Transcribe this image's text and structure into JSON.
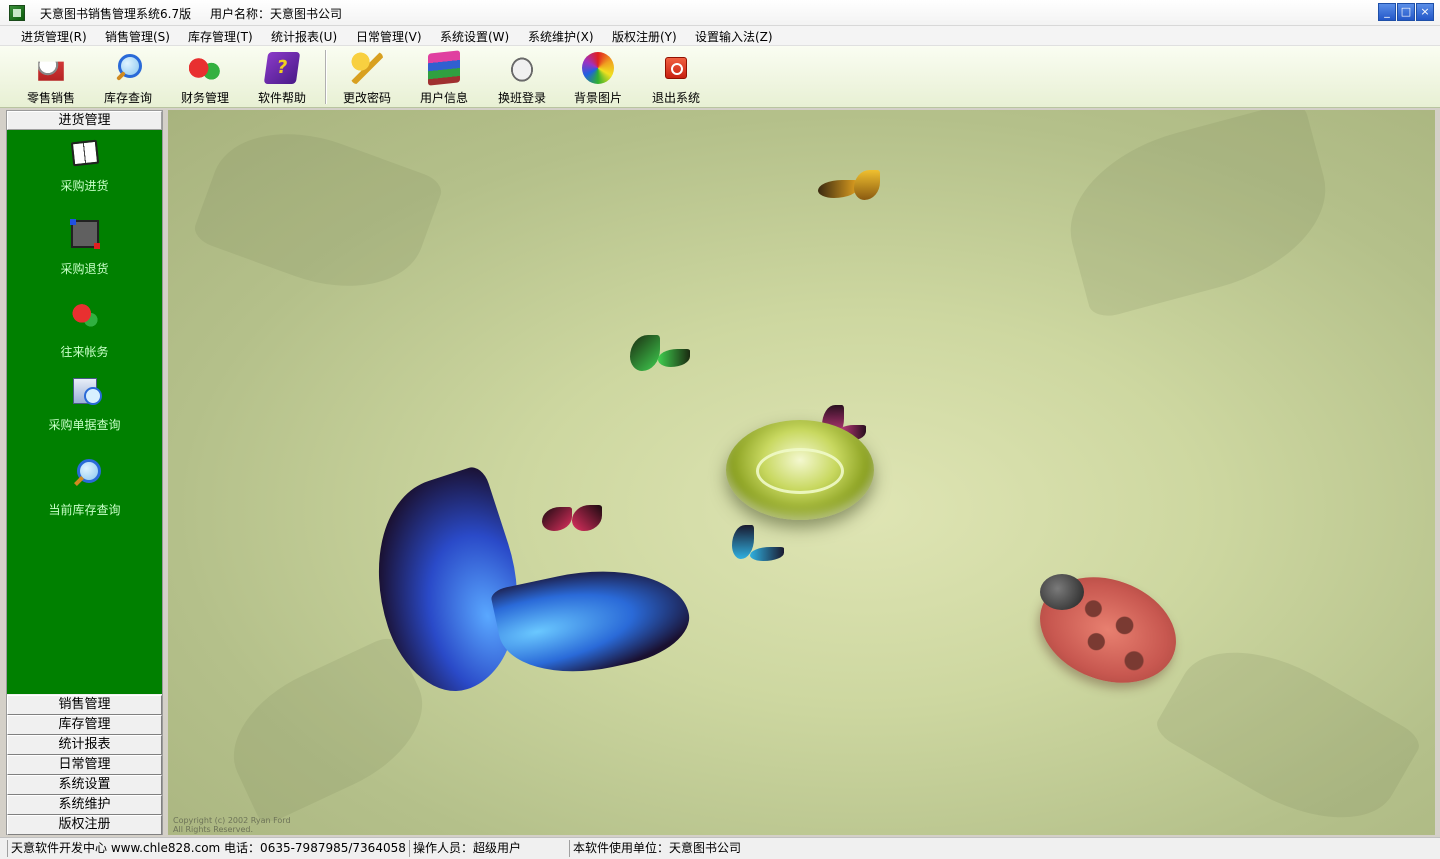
{
  "window": {
    "title": "天意图书销售管理系统6.7版",
    "user": "用户名称：天意图书公司",
    "controls": [
      "_",
      "□",
      "×"
    ]
  },
  "menu": [
    "进货管理(R)",
    "销售管理(S)",
    "库存管理(T)",
    "统计报表(U)",
    "日常管理(V)",
    "系统设置(W)",
    "系统维护(X)",
    "版权注册(Y)",
    "设置输入法(Z)"
  ],
  "toolbar": [
    {
      "label": "零售销售",
      "icon": "cash-register-icon"
    },
    {
      "label": "库存查询",
      "icon": "magnifier-icon"
    },
    {
      "label": "财务管理",
      "icon": "money-icon"
    },
    {
      "label": "软件帮助",
      "icon": "help-book-icon"
    },
    {
      "label": "更改密码",
      "icon": "key-icon"
    },
    {
      "label": "用户信息",
      "icon": "books-icon"
    },
    {
      "label": "换班登录",
      "icon": "handshake-icon"
    },
    {
      "label": "背景图片",
      "icon": "palette-icon"
    },
    {
      "label": "退出系统",
      "icon": "power-icon"
    }
  ],
  "sidebar": {
    "active_header": "进货管理",
    "items": [
      {
        "label": "采购进货",
        "icon": "book-icon"
      },
      {
        "label": "采购退货",
        "icon": "return-icon"
      },
      {
        "label": "往来帐务",
        "icon": "money-icon"
      },
      {
        "label": "采购单据查询",
        "icon": "document-search-icon"
      },
      {
        "label": "当前库存查询",
        "icon": "magnifier-icon"
      }
    ],
    "tabs": [
      "销售管理",
      "库存管理",
      "统计报表",
      "日常管理",
      "系统设置",
      "系统维护",
      "版权注册"
    ]
  },
  "wallpaper": {
    "copyright_line1": "Copyright (c) 2002 Ryan Ford",
    "copyright_line2": "All Rights Reserved."
  },
  "status": {
    "company": "天意软件开发中心 www.chle828.com 电话：0635-7987985/7364058",
    "operator": "操作人员：超级用户",
    "unit": "本软件使用单位：天意图书公司"
  }
}
